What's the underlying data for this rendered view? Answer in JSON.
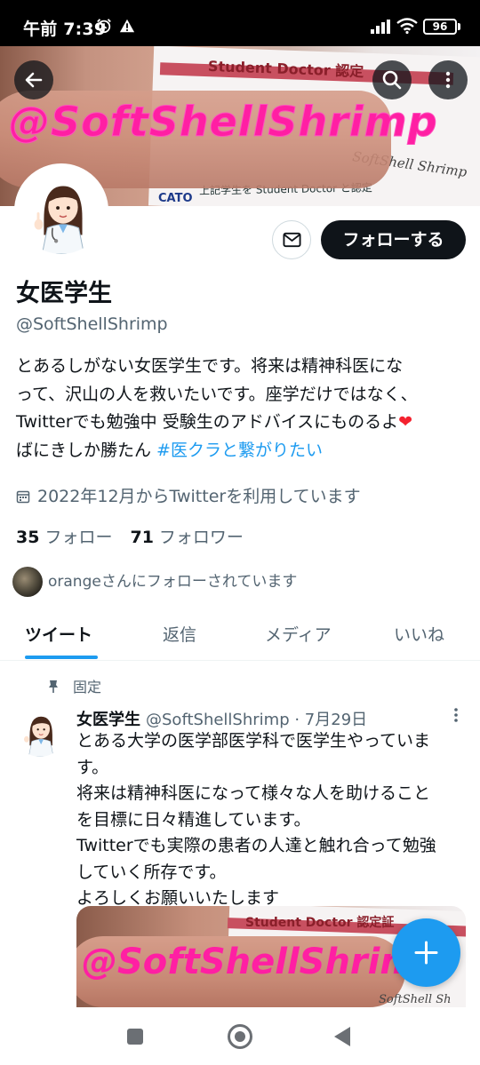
{
  "status_bar": {
    "time": "午前 7:39",
    "battery": "96"
  },
  "banner": {
    "watermark": "@SoftShellShrimp",
    "card_title": "Student Doctor  認定",
    "card_subtitle": "上記学生を Student Doctor と認定",
    "card_logo": "CATO",
    "card_signature": "SoftShell Shrimp"
  },
  "profile": {
    "display_name": "女医学生",
    "handle": "@SoftShellShrimp",
    "bio_line1": "とあるしがない女医学生です。将来は精神科医にな",
    "bio_line2": "って、沢山の人を救いたいです。座学だけではなく、",
    "bio_line3": "Twitterでも勉強中 受験生のアドバイスにものるよ",
    "bio_heart": "❤",
    "bio_line4": "ばにきしか勝たん ",
    "bio_hashtag": "#医クラと繋がりたい",
    "joined": "2022年12月からTwitterを利用しています",
    "following_count": "35",
    "following_label": "フォロー",
    "followers_count": "71",
    "followers_label": "フォロワー",
    "followed_by": "orangeさんにフォローされています",
    "follow_button": "フォローする"
  },
  "tabs": [
    {
      "label": "ツイート",
      "active": true
    },
    {
      "label": "返信",
      "active": false
    },
    {
      "label": "メディア",
      "active": false
    },
    {
      "label": "いいね",
      "active": false
    }
  ],
  "pinned_tweet": {
    "pinned_label": "固定",
    "author": "女医学生",
    "meta": "@SoftShellShrimp · 7月29日",
    "line1": "とある大学の医学部医学科で医学生やっていま",
    "line2": "す。",
    "line3": "将来は精神科医になって様々な人を助けること",
    "line4": "を目標に日々精進しています。",
    "line5": "Twitterでも実際の患者の人達と触れ合って勉強",
    "line6": "していく所存です。",
    "line7": "よろしくお願いいたします",
    "image_title": "Student Doctor  認定証",
    "image_watermark": "@SoftShellShrimp",
    "image_signature": "SoftShell Sh"
  },
  "icons": {
    "back": "arrow-left-icon",
    "search": "search-icon",
    "more": "more-vertical-icon",
    "message": "envelope-icon",
    "calendar": "calendar-icon",
    "pin": "pin-icon",
    "compose": "plus-icon"
  },
  "colors": {
    "accent": "#1d9bf0",
    "text": "#0f1419",
    "muted": "#536471",
    "watermark": "#ff1fa3",
    "heart": "#f4212e"
  }
}
